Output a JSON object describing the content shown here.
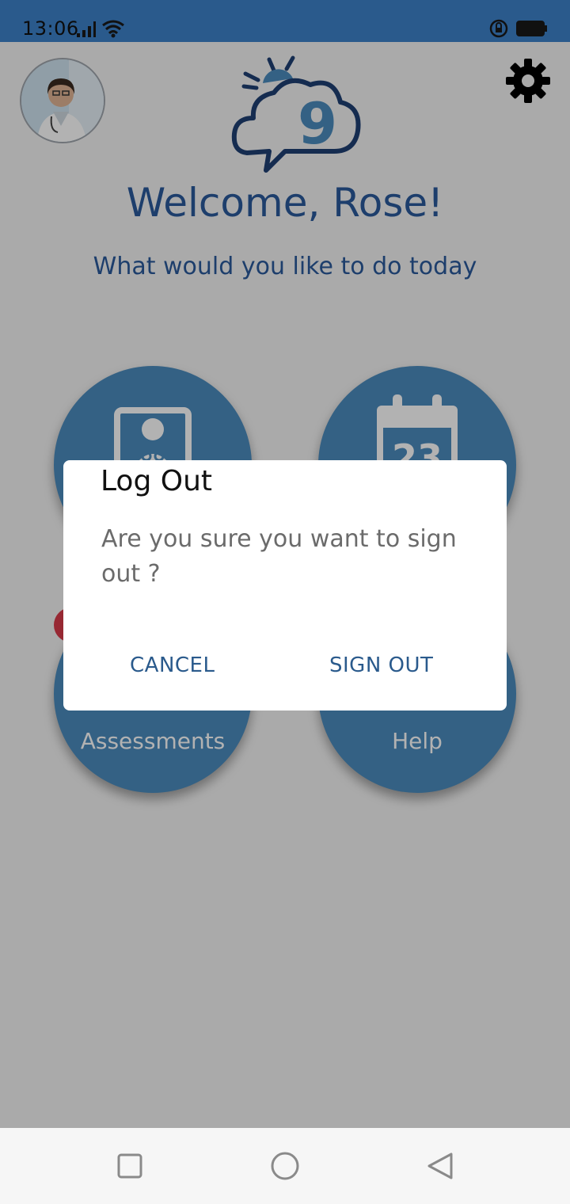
{
  "status": {
    "time": "13:06",
    "icons": [
      "signal-icon",
      "wifi-icon",
      "rotation-lock-icon",
      "battery-icon"
    ]
  },
  "header": {
    "welcome": "Welcome, Rose!",
    "subtitle": "What would you like to do today",
    "logo_number": "9"
  },
  "tiles": {
    "top_left": {
      "icon": "doctor-card-icon"
    },
    "top_right": {
      "icon": "calendar-icon",
      "calendar_day": "23"
    },
    "bottom_left": {
      "label": "Assessments"
    },
    "bottom_right": {
      "label": "Help"
    }
  },
  "dialog": {
    "title": "Log Out",
    "message": "Are you sure you want to sign out ?",
    "cancel_label": "CANCEL",
    "confirm_label": "SIGN OUT"
  },
  "navbar": {
    "icons": [
      "recent-apps-icon",
      "home-icon",
      "back-icon"
    ]
  },
  "colors": {
    "statusbar": "#2a5a8c",
    "accent": "#2a5a9b",
    "tile": "#4b8bbd",
    "badge": "#d83a4a"
  }
}
